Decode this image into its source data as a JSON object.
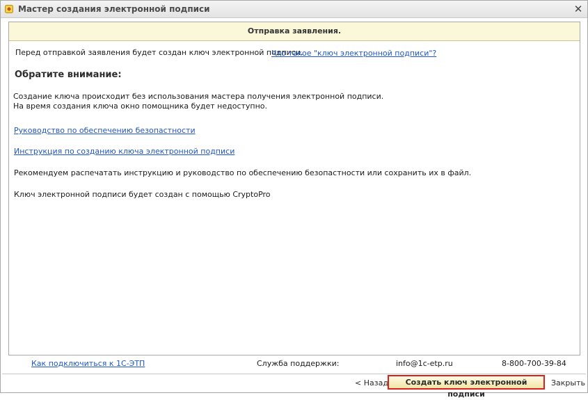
{
  "window": {
    "title": "Мастер создания электронной подписи",
    "close_symbol": "✕"
  },
  "header": {
    "title": "Отправка заявления."
  },
  "intro": {
    "text": "Перед отправкой заявления будет создан ключ электронной подписи.",
    "link": "Что такое \"ключ электронной подписи\"?"
  },
  "attention": {
    "heading": "Обратите внимание:",
    "line1": "Создание ключа происходит без использования мастера получения электронной подписи.",
    "line2": "На время создания ключа окно помощника будет недоступно."
  },
  "links": {
    "security_guide": "Руководство по обеспечению безопастности",
    "key_instruction": "Инструкция по созданию ключа электронной подписи"
  },
  "notes": {
    "print_recommendation": "Рекомендуем распечатать инструкцию и руководство по обеспечению безопастности или сохранить их в файл.",
    "cryptopro": "Ключ электронной подписи будет создан с помощью CryptoPro"
  },
  "footer": {
    "connect_link": "Как подключиться к 1С-ЭТП",
    "support_label": "Служба поддержки:",
    "email": "info@1c-etp.ru",
    "phone": "8-800-700-39-84"
  },
  "buttons": {
    "back": "< Назад",
    "create_key": "Создать ключ электронной подписи",
    "close": "Закрыть"
  },
  "colors": {
    "banner_bg": "#fbf8d9",
    "link": "#1f56c6",
    "primary_border": "#d92121"
  },
  "icons": {
    "app": "1c-app-icon",
    "close": "close-icon"
  }
}
